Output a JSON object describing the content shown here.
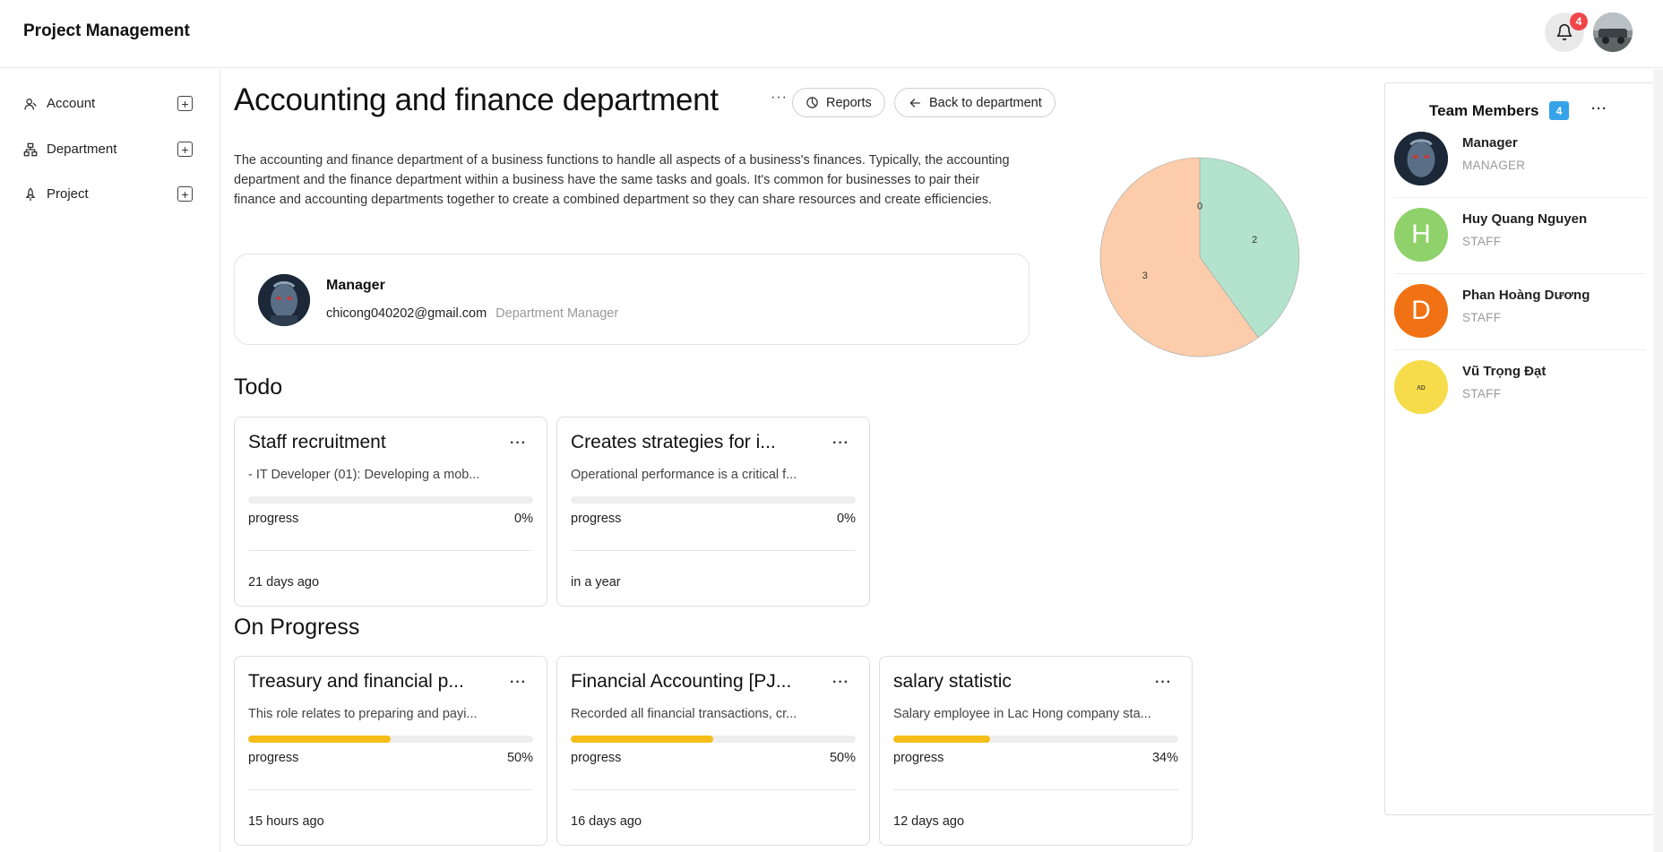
{
  "header": {
    "app_title": "Project Management",
    "notification_count": "4"
  },
  "sidebar": {
    "items": [
      {
        "label": "Account",
        "icon": "user-icon"
      },
      {
        "label": "Department",
        "icon": "sitemap-icon"
      },
      {
        "label": "Project",
        "icon": "rocket-icon"
      }
    ]
  },
  "department": {
    "title": "Accounting and finance department",
    "more_label": "···",
    "reports_label": "Reports",
    "back_label": "Back to department",
    "description": "The accounting and finance department of a business functions to handle all aspects of a business's finances. Typically, the accounting department and the finance department within a business have the same tasks and goals. It's common for businesses to pair their finance and accounting departments together to create a combined department so they can share resources and create efficiencies.",
    "manager": {
      "name": "Manager",
      "email": "chicong040202@gmail.com",
      "role": "Department Manager"
    }
  },
  "chart_data": {
    "type": "pie",
    "labels": [
      "0",
      "2",
      "3"
    ],
    "values": [
      0,
      2,
      3
    ],
    "colors": [
      "#cfe9dd",
      "#b3e3cc",
      "#fdcdab"
    ]
  },
  "todo": {
    "title": "Todo",
    "tasks": [
      {
        "title": "Staff recruitment",
        "desc": "- IT Developer (01): Developing a mob...",
        "progress_label": "progress",
        "progress": 0,
        "pct": "0%",
        "time": "21 days ago"
      },
      {
        "title": "Creates strategies for i...",
        "desc": "Operational performance is a critical f...",
        "progress_label": "progress",
        "progress": 0,
        "pct": "0%",
        "time": "in a year"
      }
    ]
  },
  "in_progress": {
    "title": "On Progress",
    "tasks": [
      {
        "title": "Treasury and financial p...",
        "desc": "This role relates to preparing and payi...",
        "progress_label": "progress",
        "progress": 50,
        "pct": "50%",
        "time": "15 hours ago"
      },
      {
        "title": "Financial Accounting [PJ...",
        "desc": "Recorded all financial transactions, cr...",
        "progress_label": "progress",
        "progress": 50,
        "pct": "50%",
        "time": "16 days ago"
      },
      {
        "title": "salary statistic",
        "desc": "Salary employee in Lac Hong company sta...",
        "progress_label": "progress",
        "progress": 34,
        "pct": "34%",
        "time": "12 days ago"
      }
    ]
  },
  "team": {
    "title": "Team Members",
    "count": "4",
    "more_label": "···",
    "members": [
      {
        "name": "Manager",
        "role": "MANAGER",
        "initial": "",
        "color": "#2a3a52"
      },
      {
        "name": "Huy Quang Nguyen",
        "role": "STAFF",
        "initial": "H",
        "color": "#8fd16a"
      },
      {
        "name": "Phan Hoàng Dương",
        "role": "STAFF",
        "initial": "D",
        "color": "#f07214"
      },
      {
        "name": "Vũ Trọng Đạt",
        "role": "STAFF",
        "initial": "",
        "color": "#f6dc4a"
      }
    ]
  }
}
